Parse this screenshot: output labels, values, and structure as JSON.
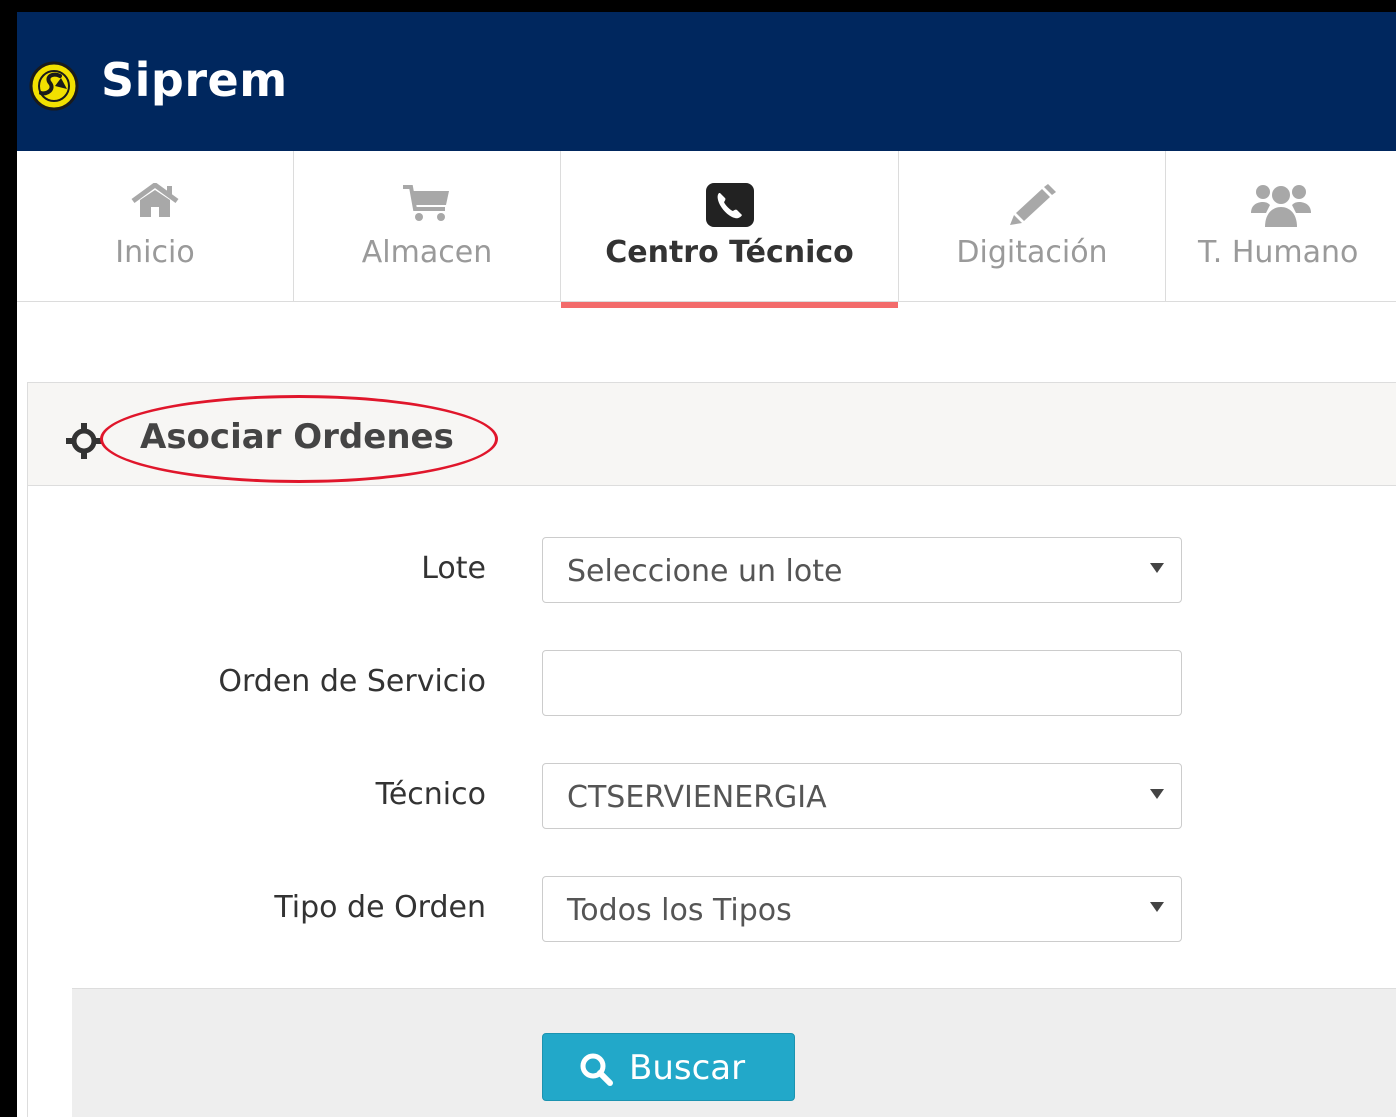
{
  "app": {
    "name": "Siprem",
    "brand_color": "#00275e",
    "accent_color": "#f36b6b"
  },
  "nav": {
    "tabs": [
      {
        "label": "Inicio",
        "icon": "home-icon",
        "active": false
      },
      {
        "label": "Almacen",
        "icon": "cart-icon",
        "active": false
      },
      {
        "label": "Centro Técnico",
        "icon": "phone-icon",
        "active": true
      },
      {
        "label": "Digitación",
        "icon": "pencil-icon",
        "active": false
      },
      {
        "label": "T. Humano",
        "icon": "users-icon",
        "active": false
      }
    ]
  },
  "panel": {
    "title": "Asociar Ordenes",
    "icon": "crosshair-icon",
    "fields": [
      {
        "label": "Lote",
        "type": "select",
        "value": "Seleccione un lote"
      },
      {
        "label": "Orden de Servicio",
        "type": "text",
        "value": ""
      },
      {
        "label": "Técnico",
        "type": "select",
        "value": "CTSERVIENERGIA"
      },
      {
        "label": "Tipo de Orden",
        "type": "select",
        "value": "Todos los Tipos"
      }
    ],
    "search_button": {
      "label": "Buscar",
      "icon": "search-icon",
      "color": "#22a8c9"
    }
  }
}
